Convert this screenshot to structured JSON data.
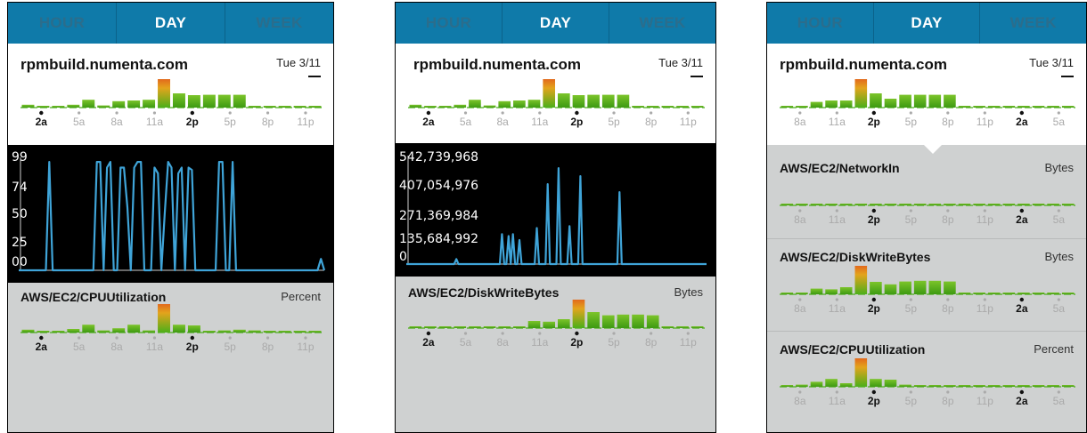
{
  "tabs": [
    "HOUR",
    "DAY",
    "WEEK"
  ],
  "host": "rpmbuild.numenta.com",
  "date": "Tue 3/11",
  "colors": {
    "tabbar": "#0f7aa9",
    "bar_green": "#4caf1a",
    "line_blue": "#3fa4d8",
    "bar_red": "#e23b1c"
  },
  "phones": [
    {
      "id": "p1",
      "header_chart": {
        "ticks": [
          "2a",
          "5a",
          "8a",
          "11a",
          "2p",
          "5p",
          "8p",
          "11p"
        ],
        "bold_ticks": [
          0,
          4
        ],
        "bars": [
          0.08,
          0.02,
          0.02,
          0.08,
          0.22,
          0.06,
          0.18,
          0.2,
          0.22,
          1.0,
          0.4,
          0.35,
          0.36,
          0.36,
          0.36,
          0.02,
          0.02,
          0.02,
          0.02,
          0.02
        ],
        "peak": 9
      },
      "detail": {
        "y_labels": [
          "99",
          "74",
          "50",
          "25",
          "00"
        ],
        "ymax": 99
      },
      "metric": {
        "name": "AWS/EC2/CPUUtilization",
        "unit": "Percent",
        "chart": {
          "ticks": [
            "2a",
            "5a",
            "8a",
            "11a",
            "2p",
            "5p",
            "8p",
            "11p"
          ],
          "bold_ticks": [
            0,
            4
          ],
          "bars": [
            0.08,
            0.02,
            0.02,
            0.1,
            0.22,
            0.06,
            0.12,
            0.22,
            0.06,
            1.0,
            0.22,
            0.2,
            0.05,
            0.06,
            0.08,
            0.06,
            0.02,
            0.02,
            0.02,
            0.02
          ],
          "peak": 9
        }
      }
    },
    {
      "id": "p2",
      "header_chart": {
        "ticks": [
          "2a",
          "5a",
          "8a",
          "11a",
          "2p",
          "5p",
          "8p",
          "11p"
        ],
        "bold_ticks": [
          0,
          4
        ],
        "bars": [
          0.08,
          0.02,
          0.02,
          0.08,
          0.22,
          0.06,
          0.18,
          0.2,
          0.22,
          1.0,
          0.4,
          0.35,
          0.36,
          0.36,
          0.36,
          0.02,
          0.02,
          0.02,
          0.02,
          0.02
        ],
        "peak": 9
      },
      "detail": {
        "y_labels": [
          "542,739,968",
          "407,054,976",
          "271,369,984",
          "135,684,992",
          "0"
        ],
        "ymax": 542739968
      },
      "metric": {
        "name": "AWS/EC2/DiskWriteBytes",
        "unit": "Bytes",
        "chart": {
          "ticks": [
            "2a",
            "5a",
            "8a",
            "11a",
            "2p",
            "5p",
            "8p",
            "11p"
          ],
          "bold_ticks": [
            0,
            4
          ],
          "bars": [
            0.02,
            0.02,
            0.02,
            0.02,
            0.02,
            0.02,
            0.02,
            0.02,
            0.2,
            0.18,
            0.25,
            1.0,
            0.45,
            0.36,
            0.38,
            0.38,
            0.36,
            0.02,
            0.02,
            0.02
          ],
          "peak": 11
        }
      }
    },
    {
      "id": "p3",
      "header_chart": {
        "ticks": [
          "8a",
          "11a",
          "2p",
          "5p",
          "8p",
          "11p",
          "2a",
          "5a"
        ],
        "bold_ticks": [
          2,
          6
        ],
        "bars": [
          0.02,
          0.02,
          0.16,
          0.2,
          0.2,
          1.0,
          0.4,
          0.25,
          0.36,
          0.36,
          0.36,
          0.36,
          0.02,
          0.02,
          0.02,
          0.02,
          0.02,
          0.02,
          0.02,
          0.02
        ],
        "peak": 5
      },
      "metrics": [
        {
          "name": "AWS/EC2/NetworkIn",
          "unit": "Bytes",
          "chart": {
            "ticks": [
              "8a",
              "11a",
              "2p",
              "5p",
              "8p",
              "11p",
              "2a",
              "5a"
            ],
            "bold_ticks": [
              2,
              6
            ],
            "bars": [
              0.02,
              0.02,
              0.02,
              0.02,
              0.02,
              0.02,
              0.02,
              0.02,
              0.02,
              0.02,
              0.02,
              0.02,
              0.02,
              0.02,
              0.02,
              0.02,
              0.02,
              0.02,
              0.02,
              0.02
            ],
            "peak": -1
          }
        },
        {
          "name": "AWS/EC2/DiskWriteBytes",
          "unit": "Bytes",
          "chart": {
            "ticks": [
              "8a",
              "11a",
              "2p",
              "5p",
              "8p",
              "11p",
              "2a",
              "5a"
            ],
            "bold_ticks": [
              2,
              6
            ],
            "bars": [
              0.02,
              0.02,
              0.16,
              0.14,
              0.2,
              1.0,
              0.35,
              0.28,
              0.36,
              0.38,
              0.38,
              0.36,
              0.02,
              0.02,
              0.02,
              0.02,
              0.02,
              0.02,
              0.02,
              0.02
            ],
            "peak": 5
          }
        },
        {
          "name": "AWS/EC2/CPUUtilization",
          "unit": "Percent",
          "chart": {
            "ticks": [
              "8a",
              "11a",
              "2p",
              "5p",
              "8p",
              "11p",
              "2a",
              "5a"
            ],
            "bold_ticks": [
              2,
              6
            ],
            "bars": [
              0.02,
              0.06,
              0.14,
              0.22,
              0.1,
              1.0,
              0.22,
              0.2,
              0.06,
              0.04,
              0.05,
              0.04,
              0.02,
              0.02,
              0.02,
              0.02,
              0.02,
              0.02,
              0.02,
              0.02
            ],
            "peak": 5
          }
        }
      ]
    }
  ],
  "chart_data": [
    {
      "type": "line",
      "series": [
        {
          "values": [
            0,
            0,
            0,
            0,
            0,
            0,
            0,
            0,
            0,
            95,
            0,
            0,
            0,
            0,
            0,
            0,
            0,
            0,
            0,
            0,
            0,
            0,
            0,
            95,
            95,
            0,
            90,
            95,
            0,
            0,
            90,
            90,
            55,
            0,
            90,
            95,
            95,
            0,
            0,
            0,
            90,
            85,
            0,
            50,
            95,
            90,
            0,
            85,
            90,
            0,
            90,
            88,
            0,
            0,
            0,
            0,
            0,
            0,
            0,
            95,
            95,
            0,
            0,
            95,
            0,
            0,
            0,
            0,
            0,
            0,
            0,
            0,
            0,
            0,
            0,
            0,
            0,
            0,
            0,
            0,
            0,
            0,
            0,
            0,
            0,
            0,
            0,
            0,
            0,
            10,
            0
          ]
        }
      ],
      "ylim": [
        0,
        99
      ]
    },
    {
      "type": "line",
      "series": [
        {
          "values": [
            0,
            0,
            0,
            0,
            0,
            0,
            0,
            0,
            0,
            0,
            0,
            0,
            0,
            0,
            0,
            0,
            0,
            0,
            0,
            0,
            0,
            0,
            0,
            25000000,
            0,
            0,
            0,
            0,
            0,
            0,
            0,
            0,
            0,
            0,
            0,
            0,
            0,
            0,
            0,
            0,
            0,
            0,
            0,
            0,
            150000000,
            0,
            0,
            140000000,
            0,
            150000000,
            0,
            0,
            120000000,
            0,
            0,
            0,
            0,
            0,
            0,
            0,
            180000000,
            0,
            0,
            0,
            0,
            400000000,
            0,
            0,
            0,
            0,
            480000000,
            0,
            0,
            0,
            0,
            190000000,
            0,
            0,
            0,
            0,
            440000000,
            0,
            0,
            0,
            0,
            0,
            0,
            0,
            0,
            0,
            0,
            0,
            0,
            0,
            0,
            0,
            0,
            0,
            360000000,
            0,
            0,
            0,
            0,
            0,
            0,
            0,
            0,
            0,
            0,
            0,
            0,
            0,
            0,
            0,
            0,
            0,
            0,
            0,
            0,
            0,
            0,
            0,
            0,
            0,
            0,
            0,
            0,
            0,
            0,
            0,
            0,
            0,
            0,
            0,
            0,
            0,
            0,
            0,
            0
          ]
        }
      ],
      "ylim": [
        0,
        542739968
      ]
    }
  ]
}
